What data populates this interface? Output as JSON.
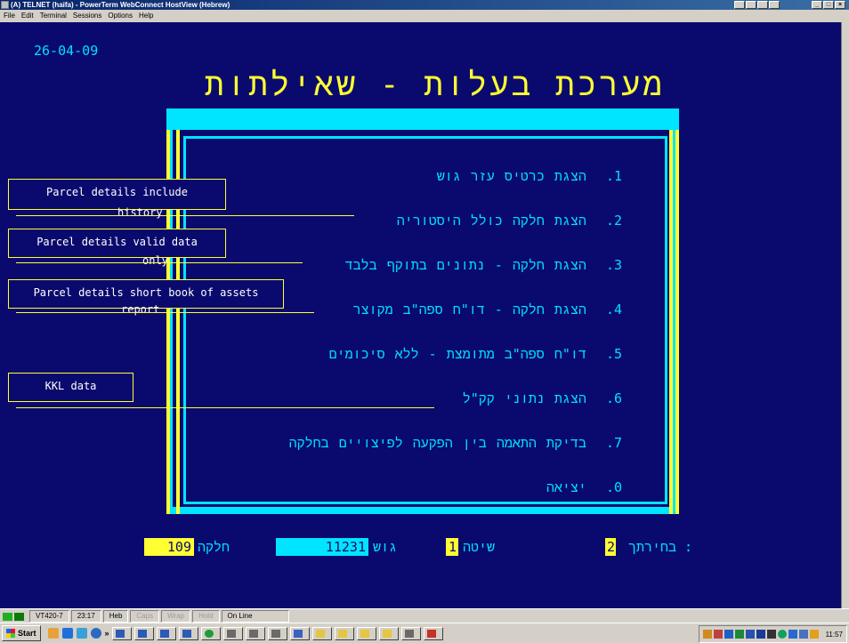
{
  "window": {
    "title": "(A) TELNET (haifa) - PowerTerm WebConnect HostView (Hebrew)",
    "buttons": [
      "_",
      "□",
      "×"
    ]
  },
  "menu": [
    "File",
    "Edit",
    "Terminal",
    "Sessions",
    "Options",
    "Help"
  ],
  "terminal": {
    "date": "26-04-09",
    "heading": "מערכת בעלות - שאילתות",
    "items": [
      {
        "num": "1.",
        "text": "הצגת כרטיס עזר גוש"
      },
      {
        "num": "2.",
        "text": "הצגת חלקה כולל היסטוריה"
      },
      {
        "num": "3.",
        "text": "הצגת חלקה - נתונים בתוקף בלבד"
      },
      {
        "num": "4.",
        "text": "הצגת חלקה - דו\"ח ספה\"ב מקוצר"
      },
      {
        "num": "5.",
        "text": "דו\"ח ספה\"ב מתומצת - ללא סיכומים"
      },
      {
        "num": "6.",
        "text": "הצגת נתוני קק\"ל"
      },
      {
        "num": "7.",
        "text": "בדיקת התאמה בין הפקעה לפיצויים בחלקה"
      },
      {
        "num": "0.",
        "text": "יציאה"
      }
    ],
    "status": {
      "parcel_label": "חלקה",
      "parcel_value": "109",
      "block_label": "גוש",
      "block_value": "11231",
      "method_label": "שיטה",
      "method_value": "1",
      "choice_label": "בחירתך :",
      "choice_value": "2"
    }
  },
  "annotations": [
    {
      "box": "Parcel details include",
      "tail": "history"
    },
    {
      "box": "Parcel details valid data",
      "tail": "only"
    },
    {
      "box": "Parcel details short book of assets",
      "tail": "report"
    },
    {
      "box": "KKL data",
      "tail": ""
    }
  ],
  "statusbar": {
    "terminal_type": "VT420-7",
    "cursor": "23:17",
    "lang": "Heb",
    "caps": "Caps",
    "wrap": "Wrap",
    "hold": "Hold",
    "online": "On Line"
  },
  "taskbar": {
    "start_label": "Start",
    "clock": "11:57"
  },
  "colors": {
    "screen_bg": "#0a0a6e",
    "cyan": "#00e5ff",
    "yellow": "#ffff33"
  }
}
